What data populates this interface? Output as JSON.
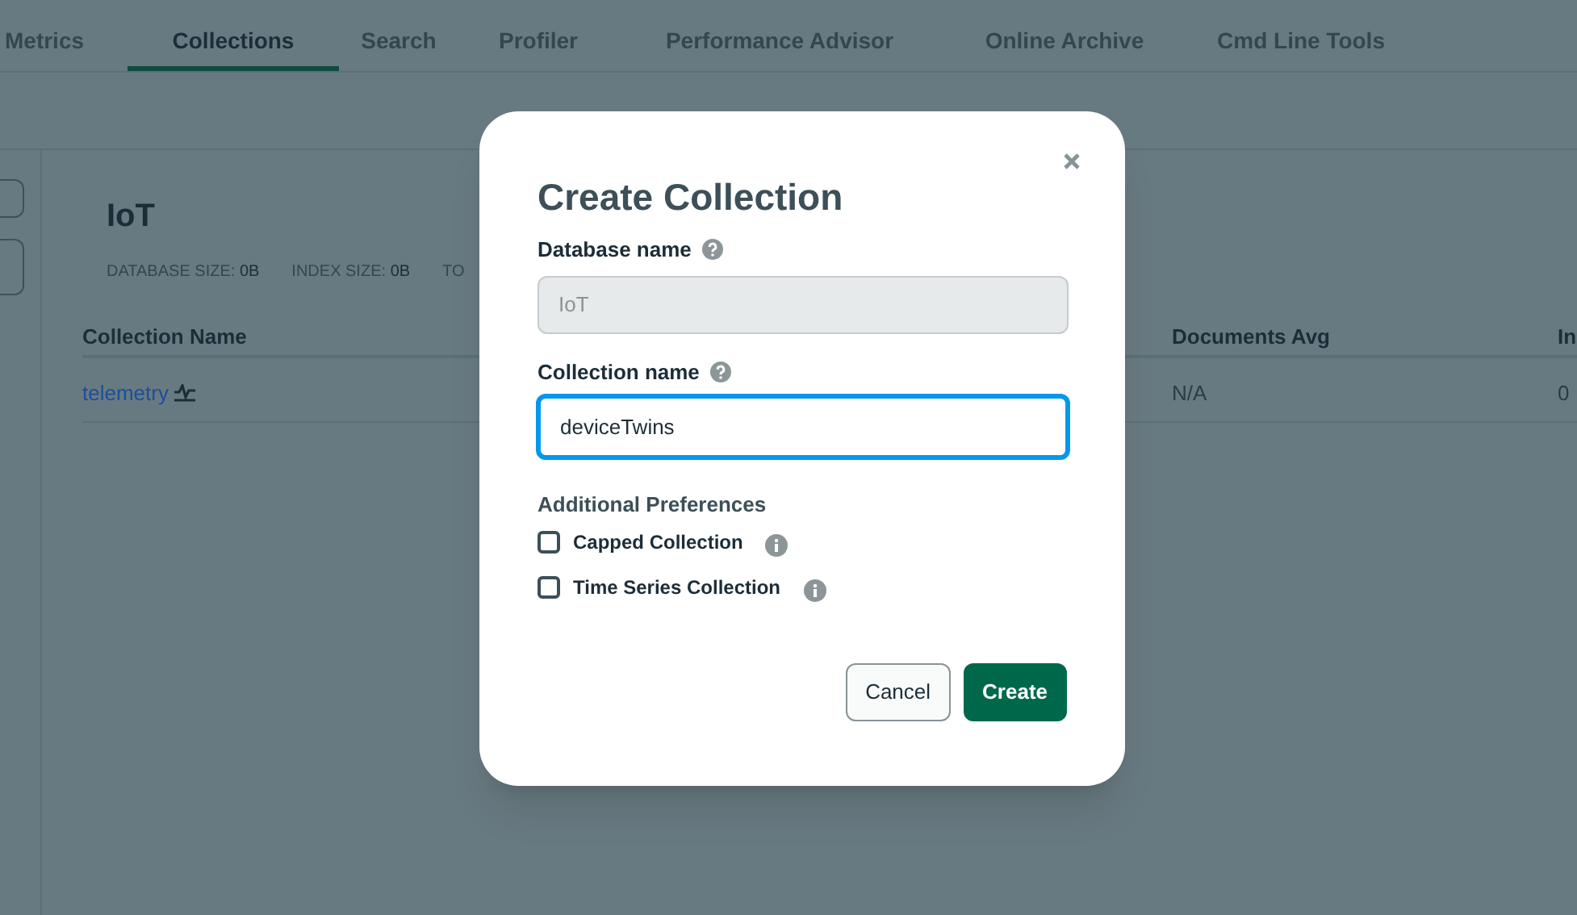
{
  "tabs": [
    {
      "label": "Metrics",
      "selected": false
    },
    {
      "label": "Collections",
      "selected": true
    },
    {
      "label": "Search",
      "selected": false
    },
    {
      "label": "Profiler",
      "selected": false
    },
    {
      "label": "Performance Advisor",
      "selected": false
    },
    {
      "label": "Online Archive",
      "selected": false
    },
    {
      "label": "Cmd Line Tools",
      "selected": false
    }
  ],
  "database": {
    "title": "IoT",
    "stats": [
      {
        "label": "DATABASE SIZE:",
        "value": "0B"
      },
      {
        "label": "INDEX SIZE:",
        "value": "0B"
      },
      {
        "label": "TO"
      }
    ]
  },
  "table": {
    "columns": [
      "Collection Name",
      "Documents Avg",
      "In"
    ],
    "rows": [
      {
        "cells": [
          "telemetry",
          "N/A",
          "0"
        ]
      }
    ]
  },
  "dialog": {
    "title": "Create Collection",
    "fields": [
      {
        "label": "Database name",
        "value": "IoT",
        "disabled": true,
        "focused": false
      },
      {
        "label": "Collection name",
        "value": "deviceTwins",
        "disabled": false,
        "focused": true
      }
    ],
    "section": "Additional Preferences",
    "options": [
      {
        "label": "Capped Collection",
        "checked": false
      },
      {
        "label": "Time Series Collection",
        "checked": false
      }
    ],
    "buttons": [
      {
        "label": "Cancel",
        "kind": "secondary"
      },
      {
        "label": "Create",
        "kind": "primary"
      }
    ]
  }
}
